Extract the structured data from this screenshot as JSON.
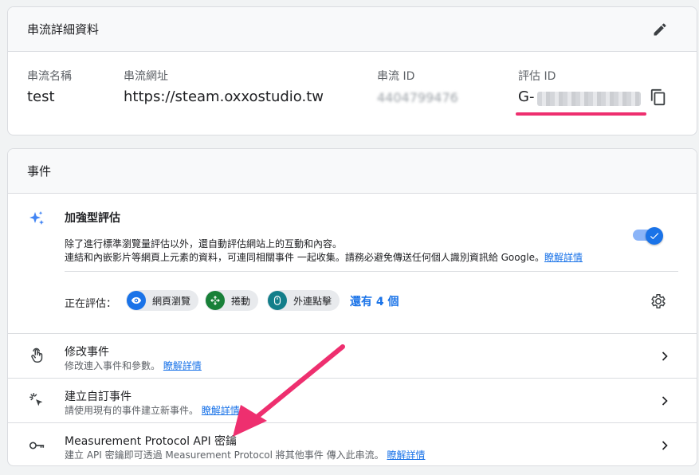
{
  "stream": {
    "header_title": "串流詳細資料",
    "name_label": "串流名稱",
    "name_value": "test",
    "url_label": "串流網址",
    "url_value": "https://steam.oxxostudio.tw",
    "id_label": "串流 ID",
    "id_value": "4404799476",
    "measurement_label": "評估 ID",
    "measurement_value_prefix": "G-",
    "icons": [
      "edit-pencil-icon",
      "copy-icon"
    ]
  },
  "events": {
    "header_title": "事件",
    "enhanced": {
      "title": "加強型評估",
      "desc_line1": "除了進行標準瀏覽量評估以外，還自動評估網站上的互動和內容。",
      "desc_line2": "連結和內嵌影片等網頁上元素的資料，可連同相關事件 一起收集。請務必避免傳送任何個人識別資訊給 Google。",
      "learn_more": "瞭解詳情",
      "toggle_on": true,
      "measuring_label": "正在評估：",
      "chips": [
        "網頁瀏覽",
        "捲動",
        "外連點擊"
      ],
      "more_link": "還有 4 個"
    },
    "rows": [
      {
        "title": "修改事件",
        "desc": "修改連入事件和參數。",
        "learn_more": "瞭解詳情",
        "icon": "touch-hand-icon"
      },
      {
        "title": "建立自訂事件",
        "desc": "請使用現有的事件建立新事件。",
        "learn_more": "瞭解詳情",
        "icon": "click-sparkle-icon"
      },
      {
        "title": "Measurement Protocol API 密鑰",
        "desc": "建立 API 密鑰即可透過 Measurement Protocol 將其他事件 傳入此串流。",
        "learn_more": "瞭解詳情",
        "icon": "key-icon"
      }
    ]
  },
  "colors": {
    "accent": "#1a73e8",
    "annotation": "#ee2f6f",
    "chip_pageview": "#1a73e8",
    "chip_scroll": "#188038",
    "chip_outbound": "#137e8a"
  }
}
